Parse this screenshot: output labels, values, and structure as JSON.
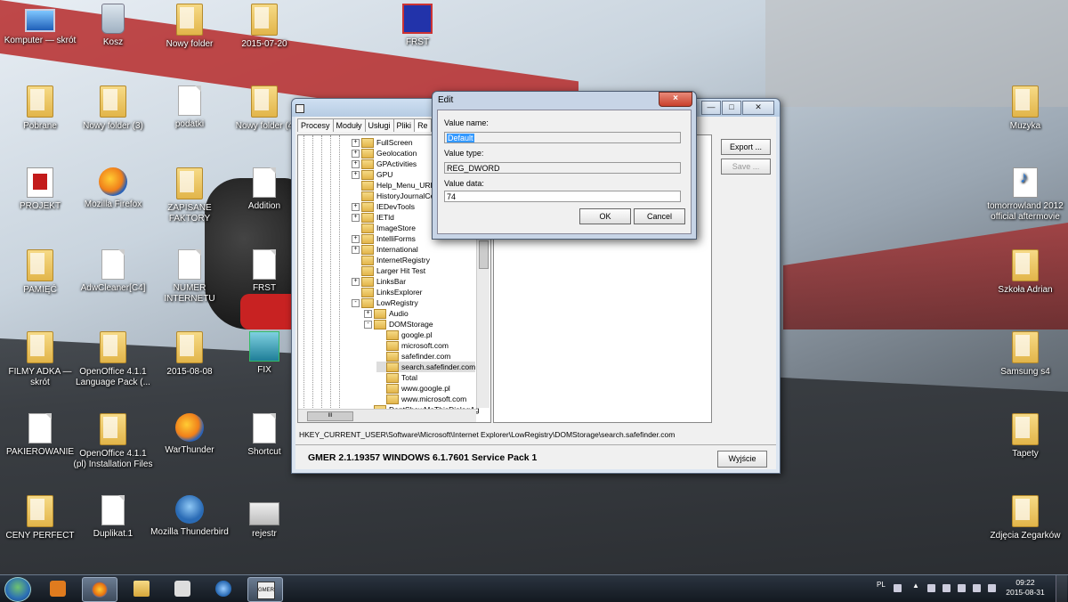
{
  "desktop_icons": [
    {
      "label": "Komputer — skrót",
      "icon": "computer-icon"
    },
    {
      "label": "Kosz",
      "icon": "recycle-bin-icon"
    },
    {
      "label": "Nowy folder",
      "icon": "folder-icon"
    },
    {
      "label": "2015-07-20",
      "icon": "folder-icon"
    },
    {
      "label": "FRST",
      "icon": "frst-icon"
    },
    {
      "label": "Pobrane",
      "icon": "downloads-folder-icon"
    },
    {
      "label": "Nowy folder (3)",
      "icon": "folder-icon"
    },
    {
      "label": "podatki",
      "icon": "document-icon"
    },
    {
      "label": "Nowy folder (4",
      "icon": "folder-icon"
    },
    {
      "label": "Muzyka",
      "icon": "folder-icon"
    },
    {
      "label": "PROJEKT",
      "icon": "pdf-icon"
    },
    {
      "label": "Mozilla Firefox",
      "icon": "firefox-icon"
    },
    {
      "label": "ZAPISANE FAKTORY",
      "icon": "folder-icon"
    },
    {
      "label": "Addition",
      "icon": "document-icon"
    },
    {
      "label": "tomorrowland 2012 official aftermovie",
      "icon": "mp3-icon"
    },
    {
      "label": "PAMIĘĆ",
      "icon": "folder-icon"
    },
    {
      "label": "AdwCleaner[C4]",
      "icon": "document-icon"
    },
    {
      "label": "NUMER INTERNETU",
      "icon": "document-icon"
    },
    {
      "label": "FRST",
      "icon": "document-icon"
    },
    {
      "label": "Szkoła Adrian",
      "icon": "folder-icon"
    },
    {
      "label": "FILMY ADKA — skrót",
      "icon": "folder-icon"
    },
    {
      "label": "OpenOffice 4.1.1 Language Pack (...",
      "icon": "folder-icon"
    },
    {
      "label": "2015-08-08",
      "icon": "folder-icon"
    },
    {
      "label": "FIX",
      "icon": "fix-icon"
    },
    {
      "label": "Samsung s4",
      "icon": "folder-icon"
    },
    {
      "label": "PAKIEROWANIE",
      "icon": "document-icon"
    },
    {
      "label": "OpenOffice 4.1.1 (pl) Installation Files",
      "icon": "folder-icon"
    },
    {
      "label": "WarThunder",
      "icon": "firefox-icon"
    },
    {
      "label": "Shortcut",
      "icon": "document-icon"
    },
    {
      "label": "Tapety",
      "icon": "folder-icon"
    },
    {
      "label": "CENY PERFECT",
      "icon": "folder-icon"
    },
    {
      "label": "Duplikat.1",
      "icon": "document-icon"
    },
    {
      "label": "Mozilla Thunderbird",
      "icon": "thunderbird-icon"
    },
    {
      "label": "rejestr",
      "icon": "image-icon"
    },
    {
      "label": "Zdjęcia Zegarków",
      "icon": "folder-icon"
    }
  ],
  "gmer": {
    "tabs": [
      "Procesy",
      "Moduły",
      "Usługi",
      "Pliki",
      "Re"
    ],
    "tree": [
      {
        "label": "FullScreen",
        "toggle": "+"
      },
      {
        "label": "Geolocation",
        "toggle": "+"
      },
      {
        "label": "GPActivities",
        "toggle": "+"
      },
      {
        "label": "GPU",
        "toggle": "+"
      },
      {
        "label": "Help_Menu_URLs",
        "toggle": ""
      },
      {
        "label": "HistoryJournalCert",
        "toggle": ""
      },
      {
        "label": "IEDevTools",
        "toggle": "+"
      },
      {
        "label": "IETld",
        "toggle": "+"
      },
      {
        "label": "ImageStore",
        "toggle": ""
      },
      {
        "label": "IntelliForms",
        "toggle": "+"
      },
      {
        "label": "International",
        "toggle": "+"
      },
      {
        "label": "InternetRegistry",
        "toggle": ""
      },
      {
        "label": "Larger Hit Test",
        "toggle": ""
      },
      {
        "label": "LinksBar",
        "toggle": "+"
      },
      {
        "label": "LinksExplorer",
        "toggle": ""
      },
      {
        "label": "LowRegistry",
        "toggle": "-"
      },
      {
        "label": "Audio",
        "toggle": "+"
      },
      {
        "label": "DOMStorage",
        "toggle": "-"
      },
      {
        "label": "google.pl",
        "toggle": ""
      },
      {
        "label": "microsoft.com",
        "toggle": ""
      },
      {
        "label": "safefinder.com",
        "toggle": ""
      },
      {
        "label": "search.safefinder.com",
        "toggle": ""
      },
      {
        "label": "Total",
        "toggle": ""
      },
      {
        "label": "www.google.pl",
        "toggle": ""
      },
      {
        "label": "www.microsoft.com",
        "toggle": ""
      },
      {
        "label": "DontShowMeThisDialogAg",
        "toggle": ""
      }
    ],
    "scroll_thumb": "III",
    "export_label": "Export ...",
    "save_label": "Save ...",
    "path": "HKEY_CURRENT_USER\\Software\\Microsoft\\Internet Explorer\\LowRegistry\\DOMStorage\\search.safefinder.com",
    "status": "GMER 2.1.19357     WINDOWS 6.1.7601 Service Pack 1",
    "exit_label": "Wyjście"
  },
  "edit_dialog": {
    "title": "Edit",
    "close": "×",
    "value_name_label": "Value name:",
    "value_name": "Default",
    "value_type_label": "Value type:",
    "value_type": "REG_DWORD",
    "value_data_label": "Value data:",
    "value_data": "74",
    "ok_label": "OK",
    "cancel_label": "Cancel"
  },
  "taskbar": {
    "language": "PL",
    "time": "09:22",
    "date": "2015-08-31",
    "buttons": [
      "media-player-icon",
      "firefox-icon",
      "explorer-icon",
      "paint-icon",
      "thunderbird-icon",
      "gmer-icon"
    ]
  }
}
